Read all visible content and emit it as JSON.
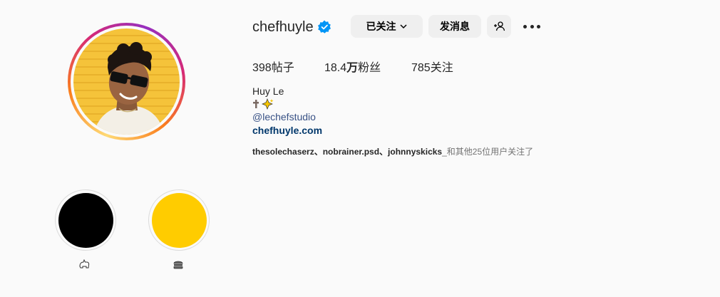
{
  "profile": {
    "username": "chefhuyle",
    "verified_icon": "verified-badge-icon",
    "full_name": "Huy Le",
    "bio_emojis": "✝️✨",
    "mention": "@lechefstudio",
    "website": "chefhuyle.com"
  },
  "actions": {
    "follow_label": "已关注",
    "message_label": "发消息",
    "add_user_icon": "add-user-icon",
    "more_icon": "more-options-icon"
  },
  "stats": {
    "posts_count": "398",
    "posts_label": "帖子",
    "followers_count": "18.4",
    "followers_unit": "万",
    "followers_label": "粉丝",
    "following_count": "785",
    "following_label": "关注"
  },
  "followed_by": {
    "names": "thesolechaserz、nobrainer.psd、johnnyskicks",
    "suffix": "_和其他25位用户关注了"
  },
  "highlights": [
    {
      "color": "#000000",
      "label_icon": "cat-emoji-icon"
    },
    {
      "color": "#ffcc00",
      "label_icon": "burger-emoji-icon"
    }
  ],
  "colors": {
    "verified": "#0095f6",
    "link": "#00376b",
    "mention": "#385185"
  }
}
